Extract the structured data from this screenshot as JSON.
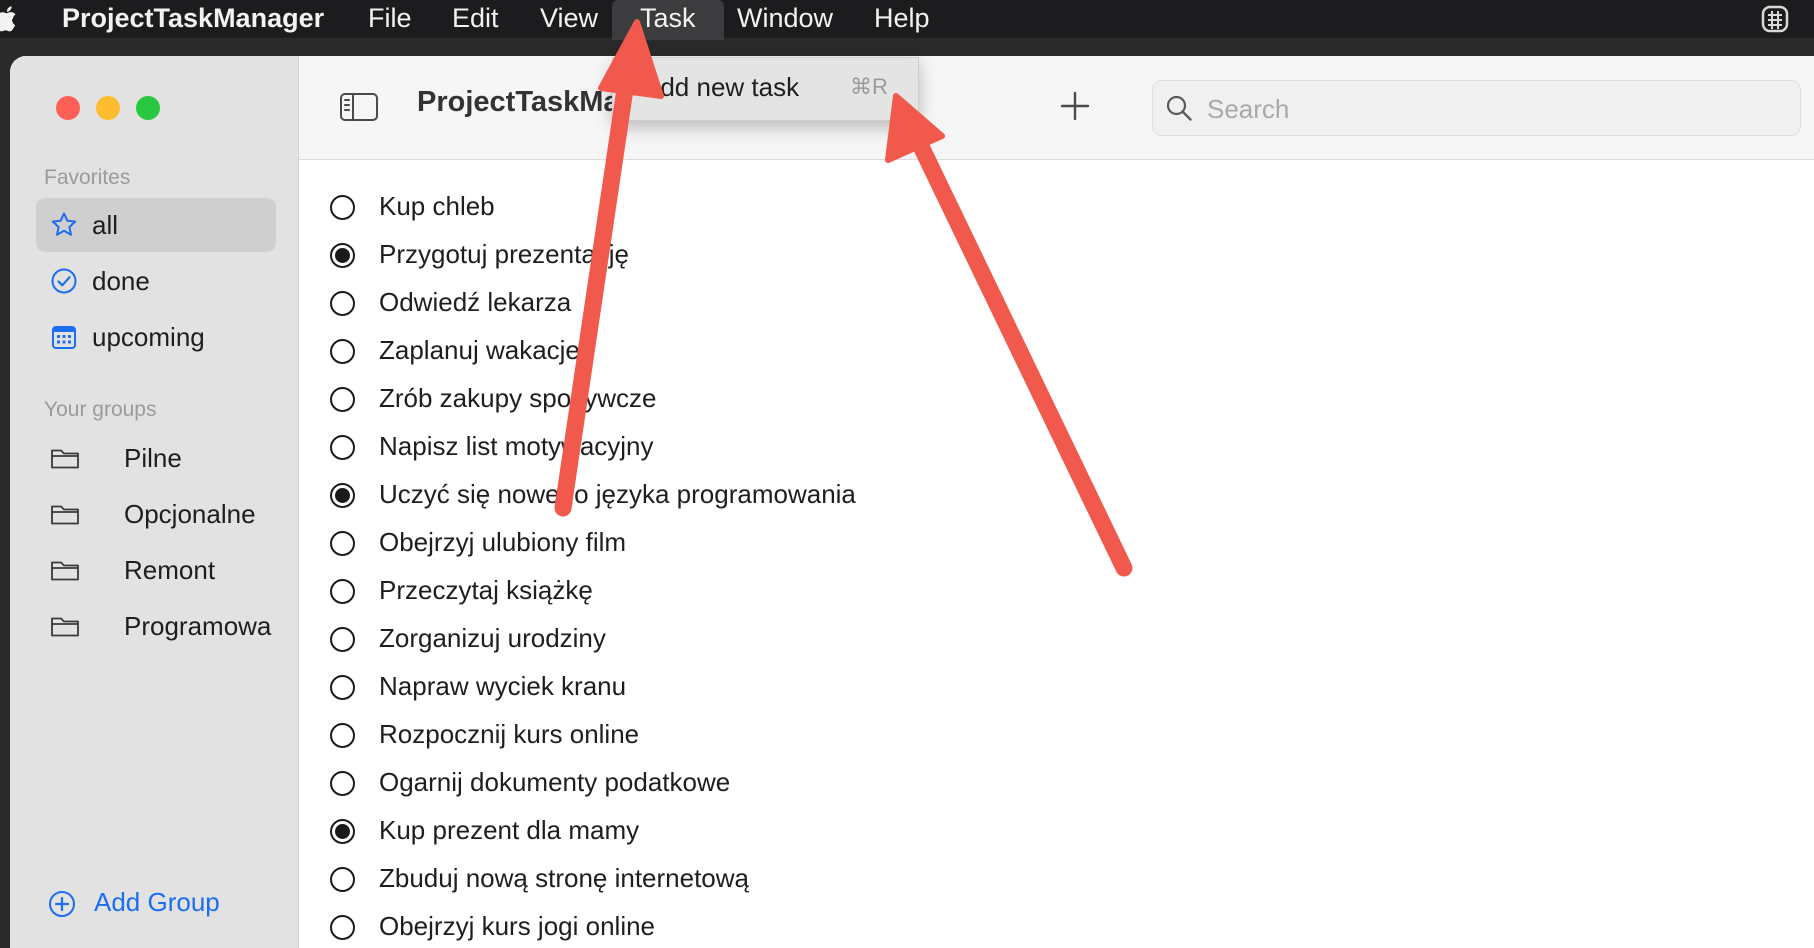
{
  "menubar": {
    "apple_icon": "apple-logo-icon",
    "app_name": "ProjectTaskManager",
    "items": [
      "File",
      "Edit",
      "View",
      "Task",
      "Window",
      "Help"
    ],
    "active_item": "Task",
    "right_icon": "status-menu-icon"
  },
  "task_menu": {
    "items": [
      {
        "label": "Add new task",
        "shortcut": "⌘R"
      }
    ]
  },
  "window": {
    "traffic_lights": {
      "close": "#fe5f57",
      "minimize": "#febc2e",
      "zoom": "#28c840"
    },
    "toolbar": {
      "title": "ProjectTaskManager",
      "sidebar_toggle_icon": "sidebar-toggle-icon",
      "add_icon": "plus-icon",
      "search": {
        "placeholder": "Search",
        "value": "",
        "icon": "search-icon"
      }
    },
    "sidebar": {
      "favorites_header": "Favorites",
      "favorites": [
        {
          "label": "all",
          "icon": "star-icon",
          "selected": true
        },
        {
          "label": "done",
          "icon": "checkmark-circle-icon",
          "selected": false
        },
        {
          "label": "upcoming",
          "icon": "calendar-icon",
          "selected": false
        }
      ],
      "groups_header": "Your groups",
      "groups": [
        {
          "label": "Pilne",
          "icon": "folder-icon"
        },
        {
          "label": "Opcjonalne",
          "icon": "folder-icon"
        },
        {
          "label": "Remont",
          "icon": "folder-icon"
        },
        {
          "label": "Programowa",
          "icon": "folder-icon"
        }
      ],
      "add_group_label": "Add Group",
      "add_group_icon": "plus-circle-icon"
    },
    "tasks": [
      {
        "title": "Kup chleb",
        "done": false
      },
      {
        "title": "Przygotuj prezentację",
        "done": true
      },
      {
        "title": "Odwiedź lekarza",
        "done": false
      },
      {
        "title": "Zaplanuj wakacje",
        "done": false
      },
      {
        "title": "Zrób zakupy spożywcze",
        "done": false
      },
      {
        "title": "Napisz list motywacyjny",
        "done": false
      },
      {
        "title": "Uczyć się nowego języka programowania",
        "done": true
      },
      {
        "title": "Obejrzyj ulubiony film",
        "done": false
      },
      {
        "title": "Przeczytaj książkę",
        "done": false
      },
      {
        "title": "Zorganizuj urodziny",
        "done": false
      },
      {
        "title": "Napraw wyciek kranu",
        "done": false
      },
      {
        "title": "Rozpocznij kurs online",
        "done": false
      },
      {
        "title": "Ogarnij dokumenty podatkowe",
        "done": false
      },
      {
        "title": "Kup prezent dla mamy",
        "done": true
      },
      {
        "title": "Zbuduj nową stronę internetową",
        "done": false
      },
      {
        "title": "Obejrzyj kurs jogi online",
        "done": false
      }
    ]
  },
  "annotations": {
    "arrow_color": "#f0594b"
  },
  "colors": {
    "accent": "#1b6ef3"
  }
}
